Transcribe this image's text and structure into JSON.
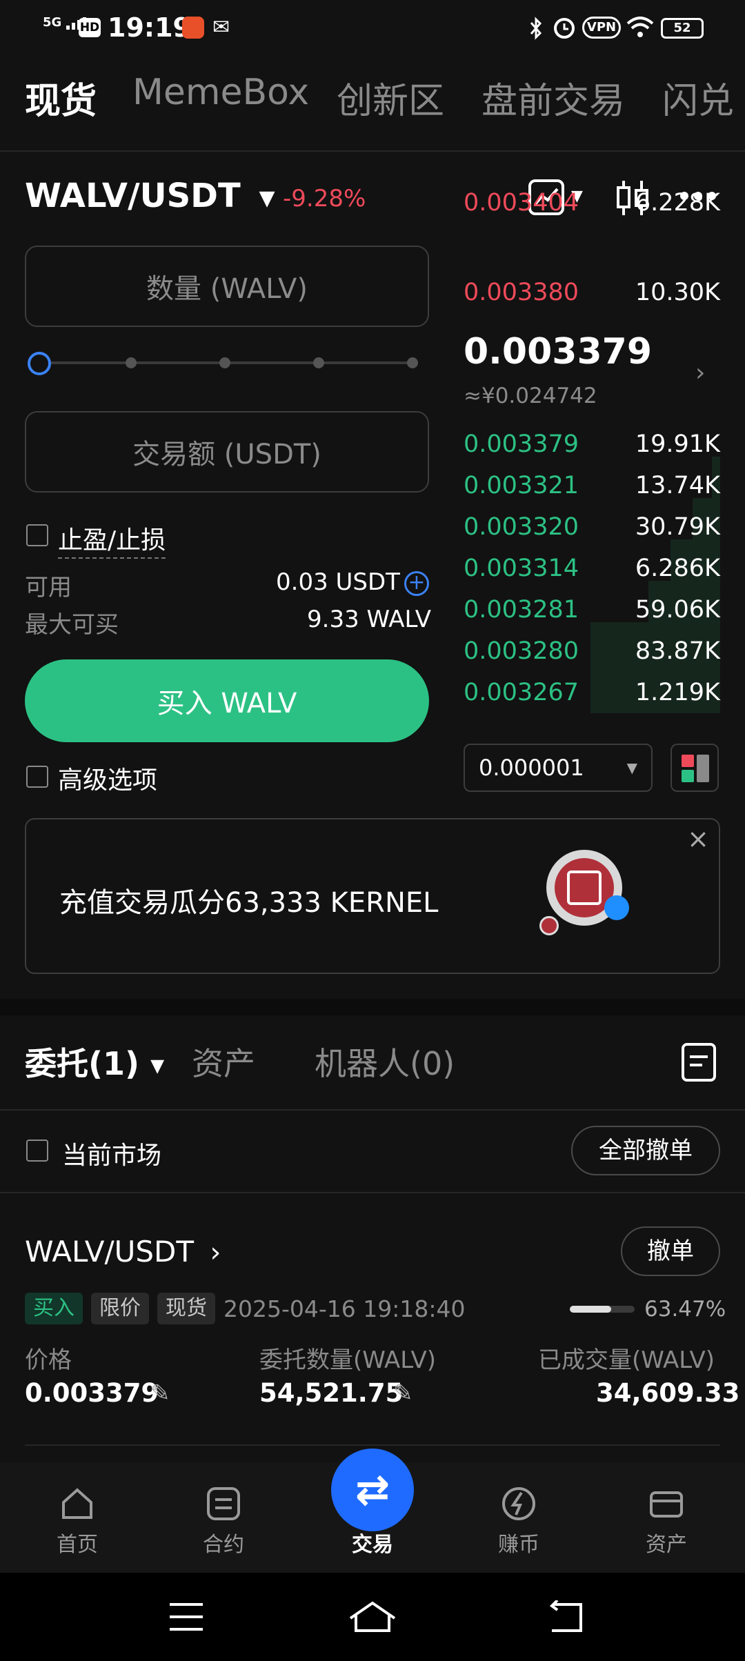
{
  "status_bar": {
    "signal": "5G",
    "time": "19:19",
    "hd": "HD",
    "battery": "52",
    "vpn": "VPN"
  },
  "top_tabs": [
    {
      "label": "现货"
    },
    {
      "label": "MemeBox"
    },
    {
      "label": "创新区"
    },
    {
      "label": "盘前交易"
    },
    {
      "label": "闪兑"
    }
  ],
  "pair": {
    "name": "WALV/USDT",
    "change": "-9.28%"
  },
  "order_form": {
    "qty_placeholder": "数量 (WALV)",
    "amount_placeholder": "交易额 (USDT)",
    "tp_sl_label": "止盈/止损",
    "available_label": "可用",
    "available_value": "0.03 USDT",
    "max_buy_label": "最大可买",
    "max_buy_value": "9.33 WALV",
    "buy_button": "买入 WALV",
    "advanced_label": "高级选项"
  },
  "orderbook": {
    "asks": [
      {
        "price": "0.003404",
        "qty": "6.228K"
      },
      {
        "price": "0.003380",
        "qty": "10.30K"
      }
    ],
    "last_price": "0.003379",
    "last_price_cny": "≈¥0.024742",
    "bids": [
      {
        "price": "0.003379",
        "qty": "19.91K"
      },
      {
        "price": "0.003321",
        "qty": "13.74K"
      },
      {
        "price": "0.003320",
        "qty": "30.79K"
      },
      {
        "price": "0.003314",
        "qty": "6.286K"
      },
      {
        "price": "0.003281",
        "qty": "59.06K"
      },
      {
        "price": "0.003280",
        "qty": "83.87K"
      },
      {
        "price": "0.003267",
        "qty": "1.219K"
      }
    ],
    "precision": "0.000001"
  },
  "banner": {
    "text": "充值交易瓜分63,333 KERNEL"
  },
  "orders_tabs": {
    "orders": "委托(1)",
    "assets": "资产",
    "bots": "机器人(0)"
  },
  "filter": {
    "current_market": "当前市场",
    "cancel_all": "全部撤单"
  },
  "order": {
    "pair": "WALV/USDT",
    "cancel": "撤单",
    "side": "买入",
    "type": "限价",
    "market": "现货",
    "time": "2025-04-16 19:18:40",
    "fill_percent": "63.47%",
    "fill_fraction": 0.6347,
    "price_label": "价格",
    "price_value": "0.003379",
    "qty_label": "委托数量(WALV)",
    "qty_value": "54,521.75",
    "filled_label": "已成交量(WALV)",
    "filled_value": "34,609.33"
  },
  "bottom_nav": [
    {
      "label": "首页"
    },
    {
      "label": "合约"
    },
    {
      "label": "交易"
    },
    {
      "label": "赚币"
    },
    {
      "label": "资产"
    }
  ],
  "colors": {
    "green": "#2cc184",
    "red": "#ef4a5a",
    "blue": "#1f6bff",
    "bg": "#121212"
  }
}
